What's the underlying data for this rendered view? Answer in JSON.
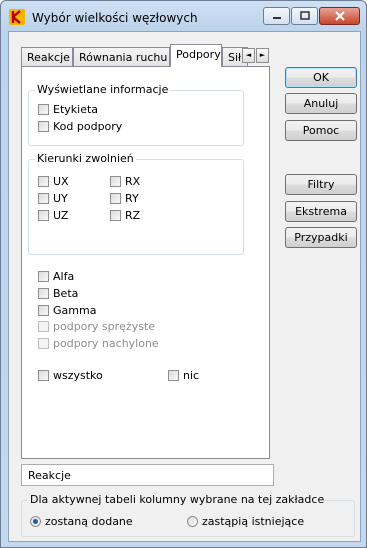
{
  "window": {
    "title": "Wybór wielkości węzłowych",
    "icon": "robot-app-icon"
  },
  "caption_buttons": {
    "minimize": "minimize-icon",
    "maximize": "maximize-icon",
    "close": "close-icon"
  },
  "tabs": [
    {
      "label": "Reakcje",
      "active": false
    },
    {
      "label": "Równania ruchu",
      "active": false
    },
    {
      "label": "Podpory",
      "active": true
    },
    {
      "label": "Sił",
      "active": false
    }
  ],
  "tab_scroll": {
    "left": "◄",
    "right": "►"
  },
  "panel": {
    "info_group": {
      "label": "Wyświetlane informacje",
      "items": [
        {
          "label": "Etykieta",
          "checked": false
        },
        {
          "label": "Kod podpory",
          "checked": false
        }
      ]
    },
    "dir_group": {
      "label": "Kierunki zwolnień",
      "left": [
        {
          "label": "UX"
        },
        {
          "label": "UY"
        },
        {
          "label": "UZ"
        }
      ],
      "right": [
        {
          "label": "RX"
        },
        {
          "label": "RY"
        },
        {
          "label": "RZ"
        }
      ]
    },
    "extra": [
      {
        "label": "Alfa",
        "disabled": false
      },
      {
        "label": "Beta",
        "disabled": false
      },
      {
        "label": "Gamma",
        "disabled": false
      },
      {
        "label": "podpory sprężyste",
        "disabled": true
      },
      {
        "label": "podpory nachylone",
        "disabled": true
      }
    ],
    "all_label": "wszystko",
    "none_label": "nic"
  },
  "buttons": {
    "ok": "OK",
    "cancel": "Anuluj",
    "help": "Pomoc",
    "filters": "Filtry",
    "extremes": "Ekstrema",
    "cases": "Przypadki"
  },
  "table_name": "Reakcje",
  "mode_group": {
    "label": "Dla aktywnej tabeli kolumny wybrane na tej zakładce",
    "option_add": "zostaną dodane",
    "option_replace": "zastąpią istniejące",
    "selected": "add"
  },
  "colors": {
    "title_bar": "#bcd3ec",
    "client_bg": "#f0f0f0",
    "radio_dot": "#1e5fa8"
  }
}
